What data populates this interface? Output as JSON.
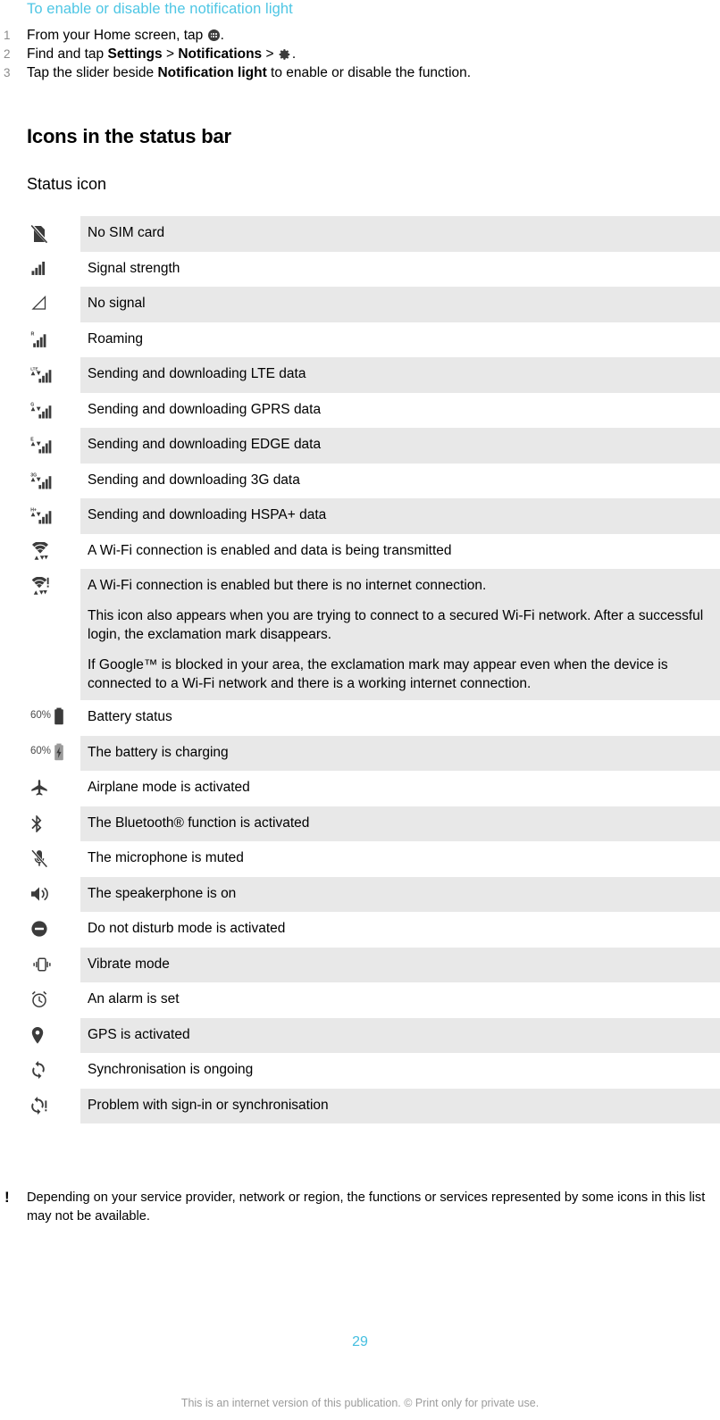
{
  "procedure": {
    "heading": "To enable or disable the notification light",
    "steps": [
      {
        "num": "1",
        "pre": "From your Home screen, tap ",
        "icon": "app-drawer-icon",
        "post": "."
      },
      {
        "num": "2",
        "pre": "Find and tap ",
        "bold1": "Settings",
        "sep1": " > ",
        "bold2": "Notifications",
        "sep2": " > ",
        "icon": "gear-icon",
        "post": "."
      },
      {
        "num": "3",
        "pre": "Tap the slider beside ",
        "bold1": "Notification light",
        "post": " to enable or disable the function."
      }
    ]
  },
  "section": {
    "title": "Icons in the status bar",
    "subtitle": "Status icon"
  },
  "icon_table": {
    "rows": [
      {
        "icon": "no-sim-card-icon",
        "shaded": true,
        "lines": [
          "No SIM card"
        ]
      },
      {
        "icon": "signal-strength-icon",
        "shaded": false,
        "lines": [
          "Signal strength"
        ]
      },
      {
        "icon": "no-signal-icon",
        "shaded": true,
        "lines": [
          "No signal"
        ]
      },
      {
        "icon": "roaming-icon",
        "shaded": false,
        "lines": [
          "Roaming"
        ]
      },
      {
        "icon": "lte-data-icon",
        "label": "LTE",
        "shaded": true,
        "lines": [
          "Sending and downloading LTE data"
        ]
      },
      {
        "icon": "gprs-data-icon",
        "label": "G",
        "shaded": false,
        "lines": [
          "Sending and downloading GPRS data"
        ]
      },
      {
        "icon": "edge-data-icon",
        "label": "E",
        "shaded": true,
        "lines": [
          "Sending and downloading EDGE data"
        ]
      },
      {
        "icon": "3g-data-icon",
        "label": "3G",
        "shaded": false,
        "lines": [
          "Sending and downloading 3G data"
        ]
      },
      {
        "icon": "hspa-plus-data-icon",
        "label": "H+",
        "shaded": true,
        "lines": [
          "Sending and downloading HSPA+ data"
        ]
      },
      {
        "icon": "wifi-connected-icon",
        "shaded": false,
        "lines": [
          "A Wi-Fi connection is enabled and data is being transmitted"
        ]
      },
      {
        "icon": "wifi-no-internet-icon",
        "shaded": true,
        "lines": [
          "A Wi-Fi connection is enabled but there is no internet connection.",
          "This icon also appears when you are trying to connect to a secured Wi-Fi network. After a successful login, the exclamation mark disappears.",
          "If Google™ is blocked in your area, the exclamation mark may appear even when the device is connected to a Wi-Fi network and there is a working internet connection."
        ]
      },
      {
        "icon": "battery-status-icon",
        "battery_percent": "60%",
        "shaded": false,
        "lines": [
          "Battery status"
        ]
      },
      {
        "icon": "battery-charging-icon",
        "battery_percent": "60%",
        "shaded": true,
        "lines": [
          "The battery is charging"
        ]
      },
      {
        "icon": "airplane-mode-icon",
        "shaded": false,
        "lines": [
          "Airplane mode is activated"
        ]
      },
      {
        "icon": "bluetooth-icon",
        "shaded": true,
        "lines": [
          "The Bluetooth® function is activated"
        ]
      },
      {
        "icon": "microphone-muted-icon",
        "shaded": false,
        "lines": [
          "The microphone is muted"
        ]
      },
      {
        "icon": "speakerphone-icon",
        "shaded": true,
        "lines": [
          "The speakerphone is on"
        ]
      },
      {
        "icon": "do-not-disturb-icon",
        "shaded": false,
        "lines": [
          "Do not disturb mode is activated"
        ]
      },
      {
        "icon": "vibrate-mode-icon",
        "shaded": true,
        "lines": [
          "Vibrate mode"
        ]
      },
      {
        "icon": "alarm-icon",
        "shaded": false,
        "lines": [
          "An alarm is set"
        ]
      },
      {
        "icon": "gps-icon",
        "shaded": true,
        "lines": [
          "GPS is activated"
        ]
      },
      {
        "icon": "sync-icon",
        "shaded": false,
        "lines": [
          "Synchronisation is ongoing"
        ]
      },
      {
        "icon": "sync-problem-icon",
        "shaded": true,
        "lines": [
          "Problem with sign-in or synchronisation"
        ]
      }
    ]
  },
  "note": {
    "mark": "!",
    "text": "Depending on your service provider, network or region, the functions or services represented by some icons in this list may not be available."
  },
  "footer": {
    "page_number": "29",
    "disclaimer": "This is an internet version of this publication. © Print only for private use."
  },
  "colors": {
    "heading_cyan": "#4ec6e4",
    "row_shade": "#e8e8e8",
    "icon_dark": "#3b3b3b",
    "footer_grey": "#9b9b9b"
  }
}
